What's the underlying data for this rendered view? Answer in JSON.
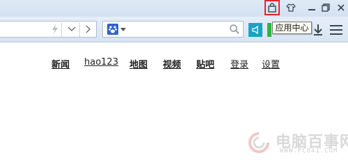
{
  "titlebar": {
    "buttons": [
      "app-center",
      "skin",
      "minimize",
      "maximize",
      "close"
    ]
  },
  "tooltip": {
    "text": "应用中心"
  },
  "nav": {
    "links": [
      {
        "label": "新闻",
        "bold": true
      },
      {
        "label": "hao123",
        "bold": false
      },
      {
        "label": "地图",
        "bold": true
      },
      {
        "label": "视频",
        "bold": true
      },
      {
        "label": "贴吧",
        "bold": true
      },
      {
        "label": "登录",
        "bold": false
      },
      {
        "label": "设置",
        "bold": false
      }
    ]
  },
  "watermark": {
    "title": "电脑百事网",
    "url": "WWW.PC841.COM"
  },
  "colors": {
    "highlight": "#e0262c",
    "accent": "#1aa3c2",
    "green": "#2fb344"
  }
}
